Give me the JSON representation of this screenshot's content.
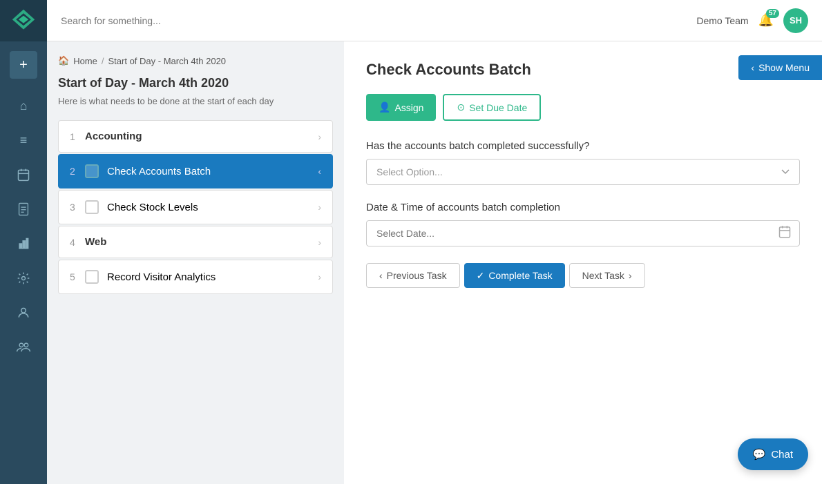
{
  "app": {
    "logo_alt": "App Logo"
  },
  "topbar": {
    "search_placeholder": "Search for something...",
    "team_name": "Demo Team",
    "notification_count": "57",
    "avatar_initials": "SH"
  },
  "breadcrumb": {
    "home_label": "Home",
    "separator": "/",
    "current": "Start of Day - March 4th 2020"
  },
  "left_panel": {
    "title": "Start of Day - March 4th 2020",
    "subtitle": "Here is what needs to be done at the start of each day",
    "tasks": [
      {
        "num": "1",
        "label": "Accounting",
        "type": "group",
        "active": false
      },
      {
        "num": "2",
        "label": "Check Accounts Batch",
        "type": "item",
        "active": true
      },
      {
        "num": "3",
        "label": "Check Stock Levels",
        "type": "item",
        "active": false
      },
      {
        "num": "4",
        "label": "Web",
        "type": "group",
        "active": false
      },
      {
        "num": "5",
        "label": "Record Visitor Analytics",
        "type": "item",
        "active": false
      }
    ]
  },
  "right_panel": {
    "show_menu_label": "Show Menu",
    "task_title": "Check Accounts Batch",
    "assign_label": "Assign",
    "set_due_date_label": "Set Due Date",
    "question_label": "Has the accounts batch completed successfully?",
    "select_placeholder": "Select Option...",
    "date_label": "Date & Time of accounts batch completion",
    "date_placeholder": "Select Date...",
    "prev_task_label": "Previous Task",
    "complete_task_label": "Complete Task",
    "next_task_label": "Next Task"
  },
  "chat": {
    "label": "Chat"
  },
  "sidebar_icons": [
    {
      "name": "home-icon",
      "glyph": "⌂"
    },
    {
      "name": "list-icon",
      "glyph": "☰"
    },
    {
      "name": "calendar-icon",
      "glyph": "📅"
    },
    {
      "name": "document-icon",
      "glyph": "📄"
    },
    {
      "name": "chart-icon",
      "glyph": "📊"
    },
    {
      "name": "wrench-icon",
      "glyph": "🔧"
    },
    {
      "name": "user-icon",
      "glyph": "👤"
    },
    {
      "name": "group-icon",
      "glyph": "👥"
    }
  ]
}
